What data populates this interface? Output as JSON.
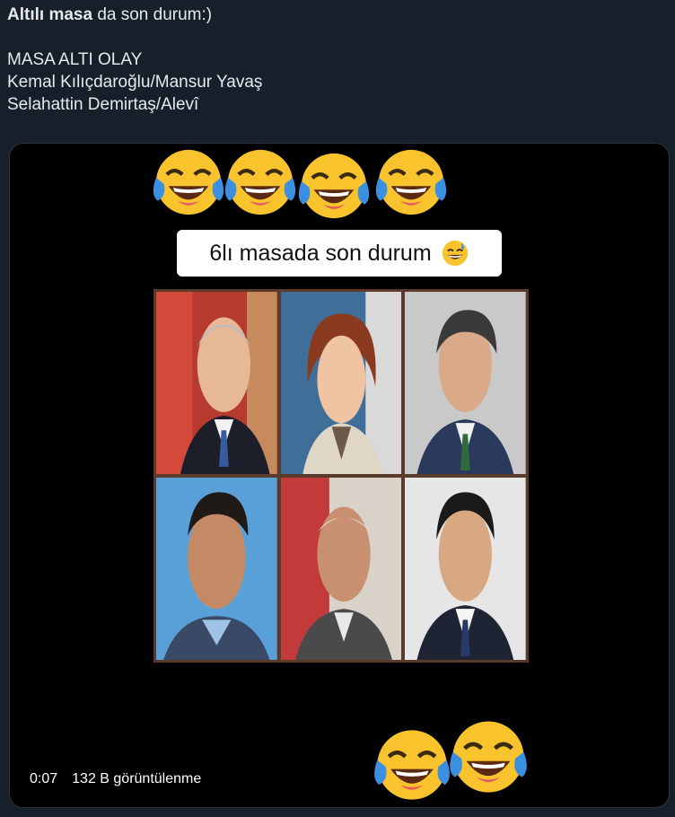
{
  "tweet": {
    "line1_bold": "Altılı masa",
    "line1_rest": " da son durum:)",
    "line2": "MASA ALTI OLAY",
    "line3": "Kemal Kılıçdaroğlu/Mansur Yavaş",
    "line4": "Selahattin Demirtaş/Alevî"
  },
  "video": {
    "caption": "6lı masada son durum",
    "time": "0:07",
    "views": "132 B görüntülenme"
  },
  "icons": {
    "laugh": "face-with-tears-of-joy-icon",
    "sweat": "grinning-face-with-sweat-icon"
  },
  "colors": {
    "background": "#15202b",
    "media_bg": "#000000",
    "emoji_yellow": "#f8c32c",
    "tear_blue": "#3b8fe0"
  }
}
